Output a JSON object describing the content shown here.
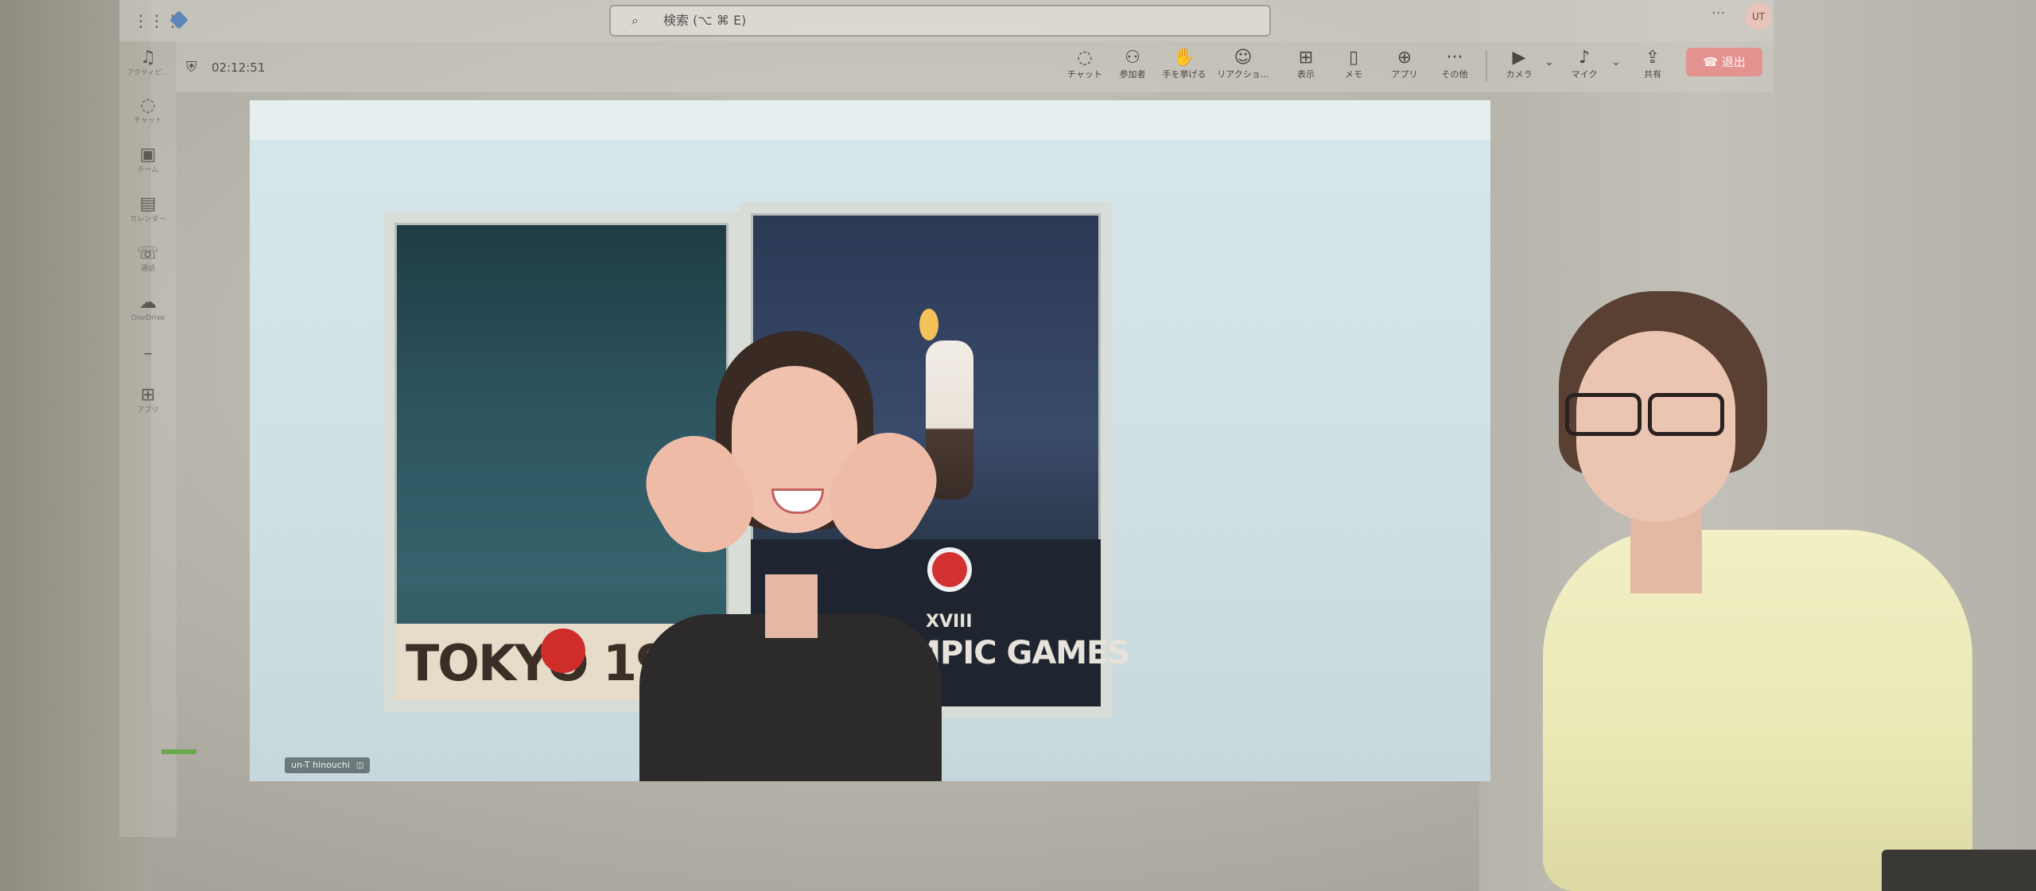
{
  "app": {
    "search_placeholder": "検索 (⌥ ⌘ E)",
    "user_initials": "UT"
  },
  "rail": {
    "items": [
      {
        "label": "アクティビ…",
        "icon": "bell-icon"
      },
      {
        "label": "チャット",
        "icon": "chat-icon"
      },
      {
        "label": "チーム",
        "icon": "teams-icon"
      },
      {
        "label": "カレンダー",
        "icon": "calendar-icon"
      },
      {
        "label": "通話",
        "icon": "phone-icon"
      },
      {
        "label": "OneDrive",
        "icon": "cloud-icon"
      },
      {
        "label": "",
        "icon": "more-icon"
      },
      {
        "label": "アプリ",
        "icon": "apps-icon"
      }
    ]
  },
  "call": {
    "timer": "02:12:51",
    "controls": [
      {
        "label": "チャット",
        "icon": "chat-icon"
      },
      {
        "label": "参加者",
        "icon": "people-icon"
      },
      {
        "label": "手を挙げる",
        "icon": "hand-icon"
      },
      {
        "label": "リアクショ…",
        "icon": "emoji-icon"
      },
      {
        "label": "表示",
        "icon": "view-icon"
      },
      {
        "label": "メモ",
        "icon": "notes-icon"
      },
      {
        "label": "アプリ",
        "icon": "add-app-icon"
      },
      {
        "label": "その他",
        "icon": "ellipsis-icon"
      },
      {
        "label": "カメラ",
        "icon": "camera-icon"
      },
      {
        "label": "マイク",
        "icon": "mic-icon"
      },
      {
        "label": "共有",
        "icon": "share-icon"
      }
    ],
    "leave_label": "退出",
    "participant_name": "un-T hinouchi"
  },
  "video": {
    "poster_left_text": "TOKYO 19",
    "poster_right_numeral": "XVIII",
    "poster_right_text": "OLYMPIC GAMES"
  },
  "colors": {
    "leave_button": "#e3938f",
    "status_green": "#6aa84f"
  }
}
